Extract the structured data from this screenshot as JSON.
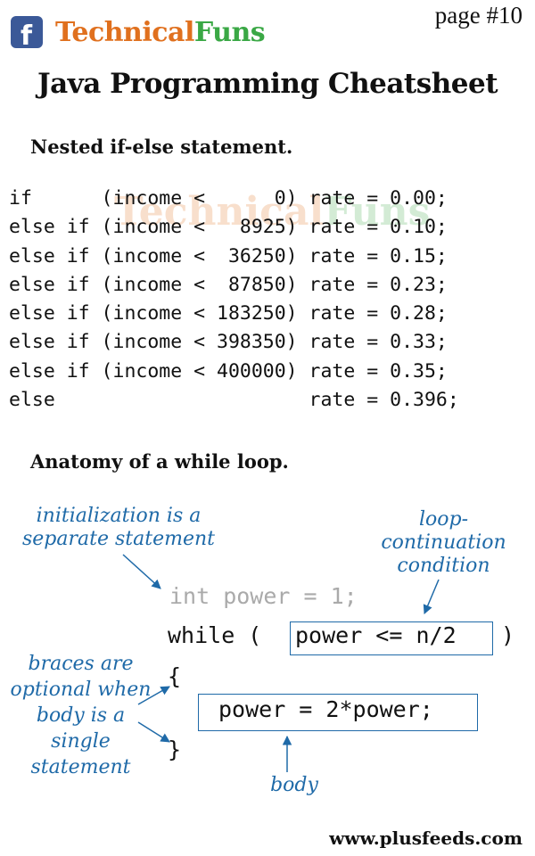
{
  "header": {
    "brand_icon": "facebook-f-icon",
    "brand_part1": "Technical",
    "brand_part2": "Funs",
    "page_number": "page #10",
    "title": "Java Programming Cheatsheet"
  },
  "nested_if": {
    "heading": "Nested if-else statement.",
    "watermark_part1": "Technical",
    "watermark_part2": "Funs",
    "code_lines": [
      "if      (income <      0) rate = 0.00;",
      "else if (income <   8925) rate = 0.10;",
      "else if (income <  36250) rate = 0.15;",
      "else if (income <  87850) rate = 0.23;",
      "else if (income < 183250) rate = 0.28;",
      "else if (income < 398350) rate = 0.33;",
      "else if (income < 400000) rate = 0.35;",
      "else                      rate = 0.396;"
    ]
  },
  "while_loop": {
    "heading": "Anatomy of a while loop.",
    "annotation_init": "initialization is a separate statement",
    "annotation_condition": "loop-continuation condition",
    "annotation_braces": "braces are optional when body is a single statement",
    "annotation_body": "body",
    "code_init": "int power = 1;",
    "code_while": "while (",
    "code_condition": "power <= n/2",
    "code_close_paren": ")",
    "code_open_brace": "{",
    "code_body": "power = 2*power;",
    "code_close_brace": "}",
    "accent_color": "#1f6aa8"
  },
  "footer": {
    "url": "www.plusfeeds.com"
  }
}
